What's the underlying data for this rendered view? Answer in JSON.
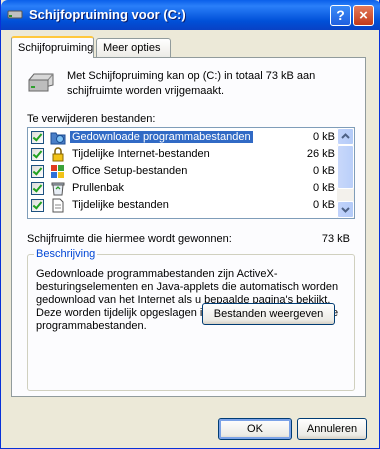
{
  "window": {
    "title": "Schijfopruiming voor  (C:)",
    "help_symbol": "?",
    "close_symbol": "×"
  },
  "tabs": [
    {
      "label": "Schijfopruiming",
      "active": true
    },
    {
      "label": "Meer opties",
      "active": false
    }
  ],
  "intro_text": "Met Schijfopruiming kan op  (C:) in totaal 73 kB aan schijfruimte worden vrijgemaakt.",
  "list_label": "Te verwijderen bestanden:",
  "files": [
    {
      "name": "Gedownloade programmabestanden",
      "size": "0 kB",
      "checked": true,
      "selected": true,
      "icon": "folder-globe-icon"
    },
    {
      "name": "Tijdelijke Internet-bestanden",
      "size": "26 kB",
      "checked": true,
      "selected": false,
      "icon": "lock-icon"
    },
    {
      "name": "Office Setup-bestanden",
      "size": "0 kB",
      "checked": true,
      "selected": false,
      "icon": "office-setup-icon"
    },
    {
      "name": "Prullenbak",
      "size": "0 kB",
      "checked": true,
      "selected": false,
      "icon": "recycle-bin-icon"
    },
    {
      "name": "Tijdelijke bestanden",
      "size": "0 kB",
      "checked": true,
      "selected": false,
      "icon": "temp-files-icon"
    }
  ],
  "gain": {
    "label": "Schijfruimte die hiermee wordt gewonnen:",
    "value": "73 kB"
  },
  "description": {
    "title": "Beschrijving",
    "text": "Gedownloade programmabestanden zijn ActiveX-besturingselementen en Java-applets die automatisch worden gedownload van het Internet als u bepaalde pagina's bekijkt. Deze worden tijdelijk opgeslagen in de map met gedownloade programmabestanden."
  },
  "buttons": {
    "view_files": "Bestanden weergeven",
    "ok": "OK",
    "cancel": "Annuleren"
  },
  "colors": {
    "title_bar": "#0054e3",
    "selection": "#316ac5",
    "group_title": "#0046d5"
  }
}
